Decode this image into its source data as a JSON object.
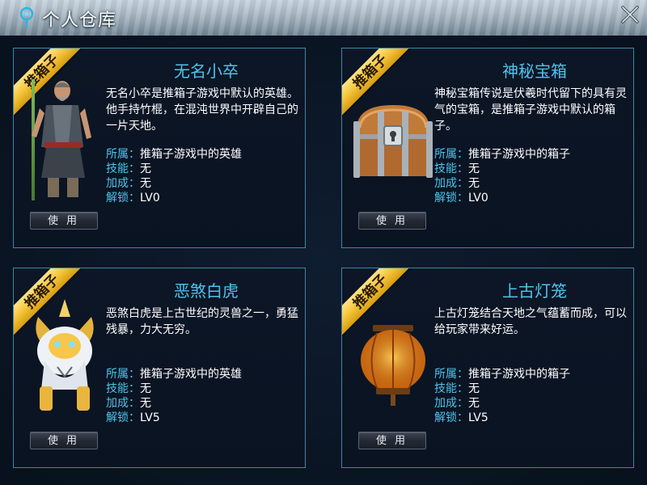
{
  "window": {
    "title": "个人仓库",
    "close_icon": "close-icon",
    "title_icon": "leaf-orb-icon"
  },
  "cards": [
    {
      "ribbon": "推箱子",
      "name": "无名小卒",
      "image": "warrior-with-bamboo-staff",
      "description": "无名小卒是推箱子游戏中默认的英雄。他手持竹棍，在混沌世界中开辟自己的一片天地。",
      "stats": [
        {
          "label": "所属：",
          "value": "推箱子游戏中的英雄"
        },
        {
          "label": "技能：",
          "value": "无"
        },
        {
          "label": "加成：",
          "value": "无"
        },
        {
          "label": "解锁：",
          "value": "LV0"
        }
      ],
      "button": "使用"
    },
    {
      "ribbon": "推箱子",
      "name": "神秘宝箱",
      "image": "treasure-chest",
      "description": "神秘宝箱传说是伏羲时代留下的具有灵气的宝箱，是推箱子游戏中默认的箱子。",
      "stats": [
        {
          "label": "所属：",
          "value": "推箱子游戏中的箱子"
        },
        {
          "label": "技能：",
          "value": "无"
        },
        {
          "label": "加成：",
          "value": "无"
        },
        {
          "label": "解锁：",
          "value": "LV0"
        }
      ],
      "button": "使用"
    },
    {
      "ribbon": "推箱子",
      "name": "恶煞白虎",
      "image": "armored-white-tiger",
      "description": "恶煞白虎是上古世纪的灵兽之一，勇猛残暴，力大无穷。",
      "stats": [
        {
          "label": "所属：",
          "value": "推箱子游戏中的英雄"
        },
        {
          "label": "技能：",
          "value": "无"
        },
        {
          "label": "加成：",
          "value": "无"
        },
        {
          "label": "解锁：",
          "value": "LV5"
        }
      ],
      "button": "使用"
    },
    {
      "ribbon": "推箱子",
      "name": "上古灯笼",
      "image": "red-lantern",
      "description": "上古灯笼结合天地之气蕴蓄而成，可以给玩家带来好运。",
      "stats": [
        {
          "label": "所属：",
          "value": "推箱子游戏中的箱子"
        },
        {
          "label": "技能：",
          "value": "无"
        },
        {
          "label": "加成：",
          "value": "无"
        },
        {
          "label": "解锁：",
          "value": "LV5"
        }
      ],
      "button": "使用"
    }
  ]
}
